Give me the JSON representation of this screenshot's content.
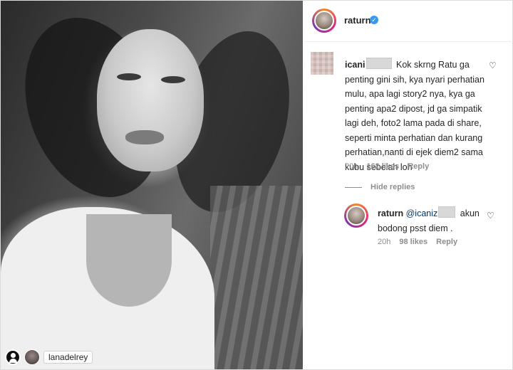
{
  "post": {
    "tag_icon": "user-tag-icon",
    "tagged_user": "lanadelrey"
  },
  "header": {
    "username": "raturn",
    "verified_icon": "verified-badge-icon"
  },
  "comment": {
    "username": "icani",
    "text": "Kok skrng Ratu ga penting gini sih, kya nyari perhatian mulu, apa lagi story2 nya, kya ga penting apa2 dipost, jd ga simpatik lagi deh, foto2 lama pada di share, seperti minta perhatian dan kurang perhatian,nanti di ejek diem2 sama kubu sebelah loh",
    "time": "20h",
    "likes": "162 likes",
    "reply_label": "Reply",
    "heart_icon": "heart-outline-icon"
  },
  "hide_replies": "Hide replies",
  "reply": {
    "username": "raturn",
    "mention": "@icaniz",
    "text": "akun bodong psst diem .",
    "time": "20h",
    "likes": "98 likes",
    "reply_label": "Reply",
    "heart_icon": "heart-outline-icon"
  },
  "colors": {
    "story_ring": [
      "#f58529",
      "#dd2a7b",
      "#8134af"
    ],
    "verified": "#3897f0",
    "meta_text": "#8e8e8e"
  }
}
